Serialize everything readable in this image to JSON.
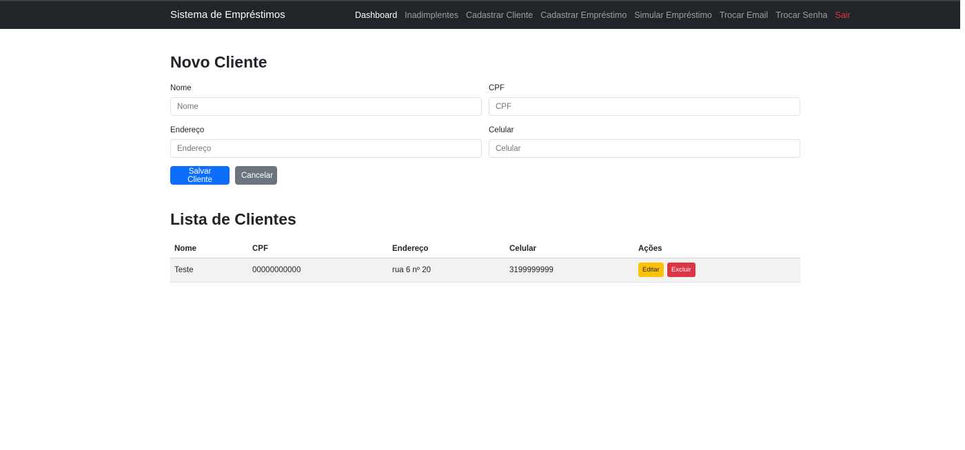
{
  "navbar": {
    "brand": "Sistema de Empréstimos",
    "links": [
      {
        "label": "Dashboard"
      },
      {
        "label": "Inadimplentes"
      },
      {
        "label": "Cadastrar Cliente"
      },
      {
        "label": "Cadastrar Empréstimo"
      },
      {
        "label": "Simular Empréstimo"
      },
      {
        "label": "Trocar Email"
      },
      {
        "label": "Trocar Senha"
      },
      {
        "label": "Sair"
      }
    ]
  },
  "form": {
    "title": "Novo Cliente",
    "fields": {
      "nome": {
        "label": "Nome",
        "placeholder": "Nome",
        "value": ""
      },
      "cpf": {
        "label": "CPF",
        "placeholder": "CPF",
        "value": ""
      },
      "endereco": {
        "label": "Endereço",
        "placeholder": "Endereço",
        "value": ""
      },
      "celular": {
        "label": "Celular",
        "placeholder": "Celular",
        "value": ""
      }
    },
    "save_label": "Salvar Cliente",
    "cancel_label": "Cancelar"
  },
  "list": {
    "title": "Lista de Clientes",
    "columns": [
      "Nome",
      "CPF",
      "Endereço",
      "Celular",
      "Ações"
    ],
    "rows": [
      {
        "nome": "Teste",
        "cpf": "00000000000",
        "endereco": "rua 6 nº 20",
        "celular": "3199999999",
        "edit_label": "Editar",
        "delete_label": "Excluir"
      }
    ]
  },
  "colors": {
    "navbar_bg": "#212529",
    "primary": "#0d6efd",
    "secondary": "#6c757d",
    "warning": "#ffc107",
    "danger": "#dc3545"
  }
}
